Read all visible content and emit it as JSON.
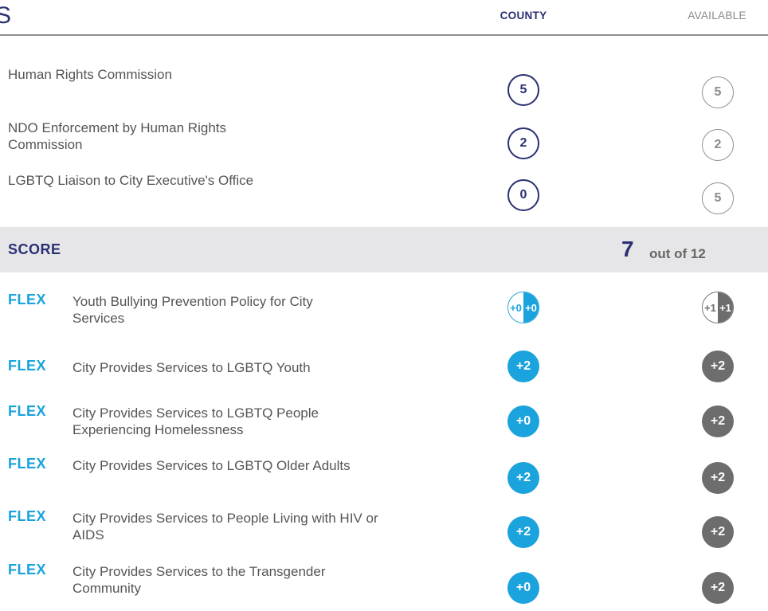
{
  "header": {
    "title_fragment": "S",
    "col_county": "COUNTY",
    "col_available": "AVAILABLE"
  },
  "items": [
    {
      "label": "Human Rights Commission",
      "county": "5",
      "available": "5"
    },
    {
      "label": "NDO Enforcement by Human Rights Commission",
      "county": "2",
      "available": "2"
    },
    {
      "label": "LGBTQ Liaison to City Executive's Office",
      "county": "0",
      "available": "5"
    }
  ],
  "score": {
    "label": "SCORE",
    "value": "7",
    "out_of": "out of 12"
  },
  "flex": {
    "tag": "FLEX",
    "items": [
      {
        "label": "Youth Bullying Prevention Policy for City Services",
        "county_left": "+0",
        "county_right": "+0",
        "available_left": "+1",
        "available_right": "+1"
      },
      {
        "label": "City Provides Services to LGBTQ Youth",
        "county": "+2",
        "available": "+2"
      },
      {
        "label": "City Provides Services to LGBTQ People Experiencing Homelessness",
        "county": "+0",
        "available": "+2"
      },
      {
        "label": "City Provides Services to LGBTQ Older Adults",
        "county": "+2",
        "available": "+2"
      },
      {
        "label": "City Provides Services to People Living with HIV or AIDS",
        "county": "+2",
        "available": "+2"
      },
      {
        "label": "City Provides Services to the Transgender Community",
        "county": "+0",
        "available": "+2"
      }
    ]
  },
  "colors": {
    "navy": "#2a3072",
    "flex_blue": "#1aa3dc",
    "dark_gray": "#6d6d6e",
    "band_gray": "#e6e6e8"
  }
}
